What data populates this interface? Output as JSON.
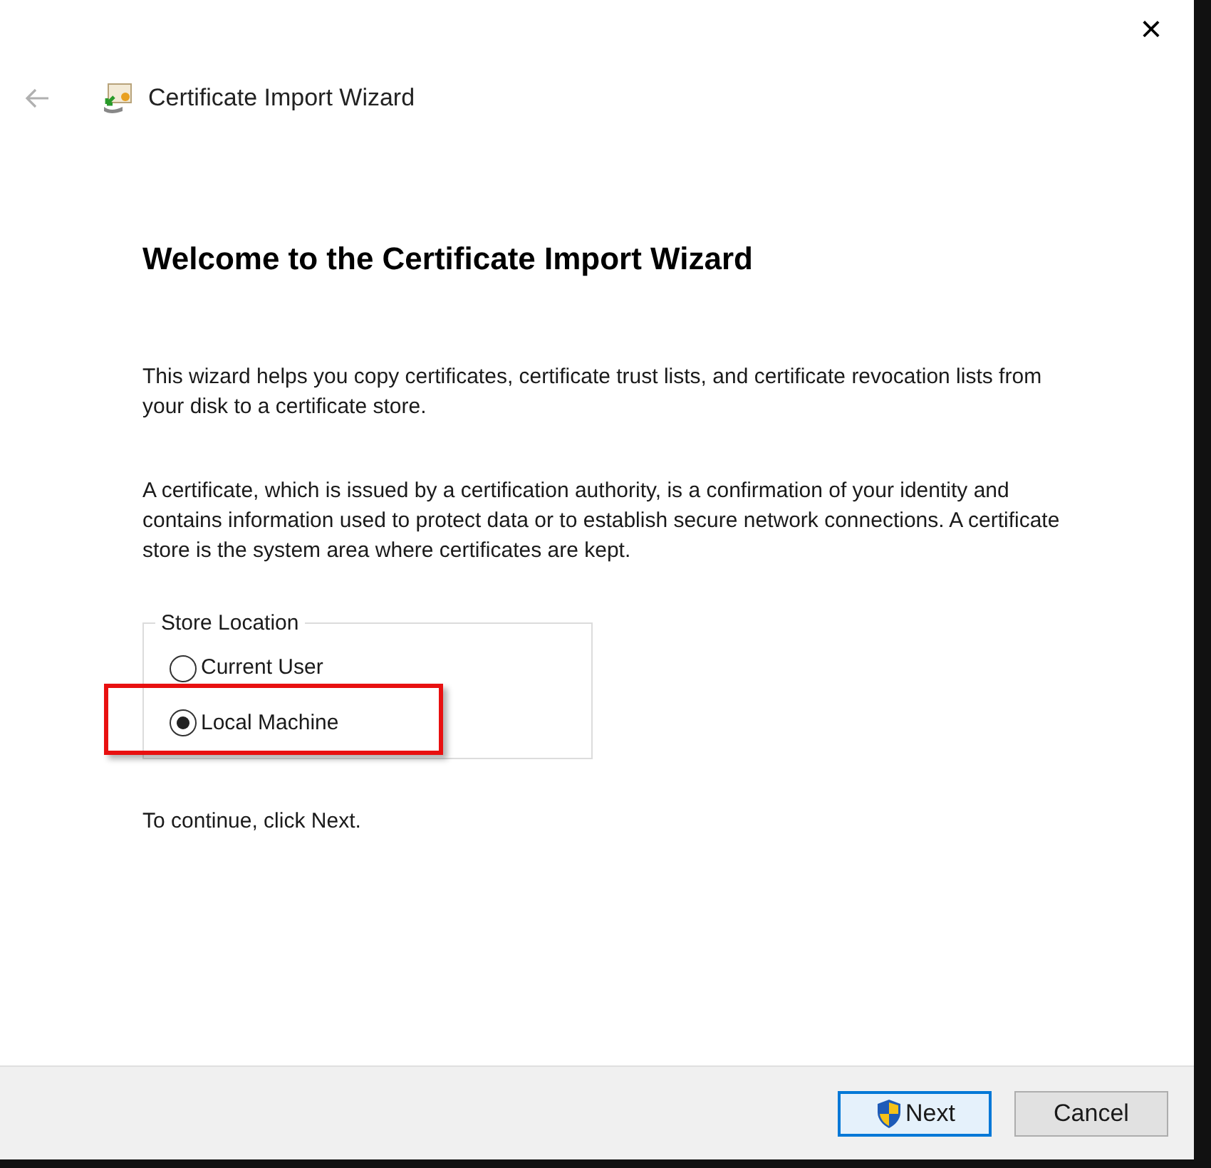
{
  "window": {
    "title": "Certificate Import Wizard",
    "close": "×"
  },
  "heading": "Welcome to the Certificate Import Wizard",
  "paragraphs": [
    "This wizard helps you copy certificates, certificate trust lists, and certificate revocation lists from your disk to a certificate store.",
    "A certificate, which is issued by a certification authority, is a confirmation of your identity and contains information used to protect data or to establish secure network connections. A certificate store is the system area where certificates are kept."
  ],
  "store_location": {
    "label": "Store Location",
    "options": [
      {
        "label": "Current User",
        "selected": false,
        "highlighted": false
      },
      {
        "label": "Local Machine",
        "selected": true,
        "highlighted": true
      }
    ]
  },
  "hint": "To continue, click Next.",
  "buttons": [
    {
      "label": "Next",
      "kind": "primary"
    },
    {
      "label": "Cancel",
      "kind": "secondary"
    }
  ]
}
